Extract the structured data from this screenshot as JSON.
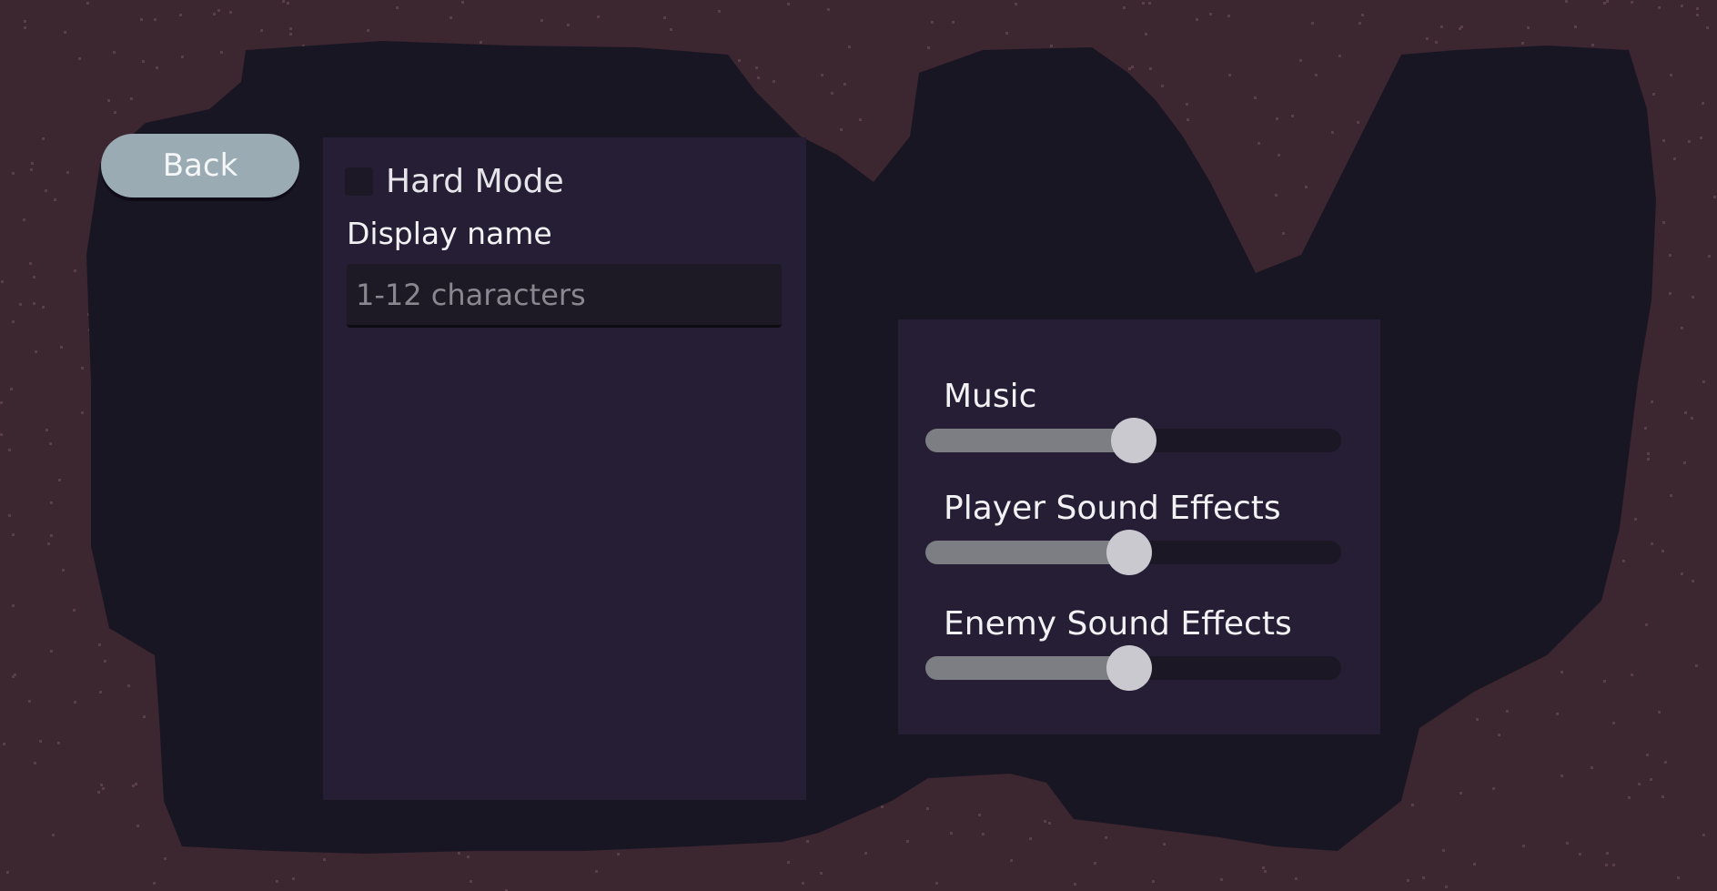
{
  "colors": {
    "outer_background": "#3c262f",
    "inner_background": "#191624",
    "panel": "#251e35",
    "back_button": "#9aabb4",
    "slider_fill": "#7d7d84",
    "slider_track": "#1b1724",
    "slider_thumb": "#c9c9cf"
  },
  "back_button": {
    "label": "Back"
  },
  "profile_panel": {
    "hard_mode": {
      "label": "Hard Mode",
      "checked": false
    },
    "display_name": {
      "label": "Display name",
      "placeholder": "1-12 characters",
      "value": ""
    }
  },
  "audio_panel": {
    "sliders": [
      {
        "label": "Music",
        "value": 0.5
      },
      {
        "label": "Player Sound Effects",
        "value": 0.49
      },
      {
        "label": "Enemy Sound Effects",
        "value": 0.49
      }
    ]
  }
}
